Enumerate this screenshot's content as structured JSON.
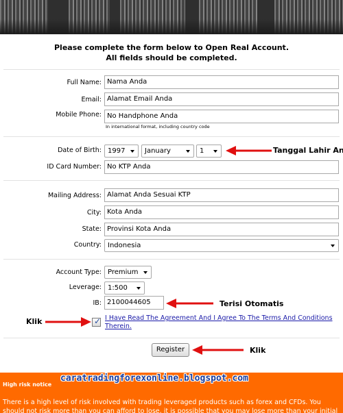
{
  "intro": {
    "line1": "Please complete the form below to Open Real Account.",
    "line2": "All fields should be completed."
  },
  "form": {
    "full_name": {
      "label": "Full Name:",
      "value": "Nama Anda"
    },
    "email": {
      "label": "Email:",
      "value": "Alamat Email Anda"
    },
    "mobile_phone": {
      "label": "Mobile Phone:",
      "value": "No Handphone Anda",
      "hint": "In international format, including country code"
    },
    "dob": {
      "label": "Date of Birth:",
      "year": "1997",
      "month": "January",
      "day": "1"
    },
    "id_card": {
      "label": "ID Card Number:",
      "value": "No KTP Anda"
    },
    "mailing_address": {
      "label": "Mailing Address:",
      "value": "Alamat Anda Sesuai KTP"
    },
    "city": {
      "label": "City:",
      "value": "Kota Anda"
    },
    "state": {
      "label": "State:",
      "value": "Provinsi Kota Anda"
    },
    "country": {
      "label": "Country:",
      "value": "Indonesia"
    },
    "account_type": {
      "label": "Account Type:",
      "value": "Premium"
    },
    "leverage": {
      "label": "Leverage:",
      "value": "1:500"
    },
    "ib": {
      "label": "IB:",
      "value": "2100044605"
    },
    "agreement": {
      "checked": true,
      "text": "I Have Read The Agreement And I Agree To The Terms And Conditions Therein."
    },
    "register_label": "Register"
  },
  "annotations": {
    "dob": "Tanggal Lahir Anda",
    "ib": "Terisi Otomatis",
    "checkbox": "Klik",
    "register": "Klik"
  },
  "risk": {
    "title": "High risk notice",
    "body": "There is a high level of risk involved with trading leveraged products such as forex and CFDs. You should not risk more than you can afford to lose, it is possible that you may lose more than your initial"
  },
  "watermark": "caratradingforexonline.blogspot.com",
  "colors": {
    "risk_banner": "#ff6a00",
    "annotation_arrow": "#e01010",
    "watermark": "#1a3c9c",
    "link": "#1a1aa8"
  }
}
